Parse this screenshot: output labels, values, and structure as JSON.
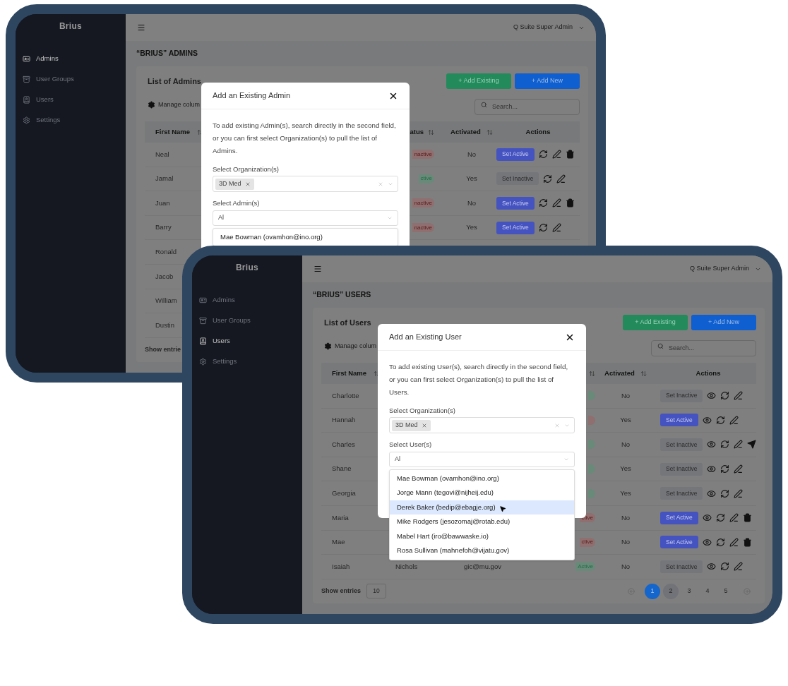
{
  "frames": [
    {
      "sidebar": {
        "brand": "Brius",
        "items": [
          {
            "label": "Admins",
            "selected": true
          },
          {
            "label": "User Groups",
            "selected": false
          },
          {
            "label": "Users",
            "selected": false
          },
          {
            "label": "Settings",
            "selected": false
          }
        ]
      },
      "header": {
        "user": "Q Suite Super Admin"
      },
      "page_title": "“BRIUS” ADMINS",
      "card": {
        "title": "List of Admins",
        "buttons": [
          {
            "label": "+ Add Existing",
            "kind": "secondary"
          },
          {
            "label": "+ Add New",
            "kind": "primary"
          }
        ],
        "manage_columns": "Manage colum",
        "search": {
          "placeholder": "Search..."
        },
        "headers": [
          {
            "kind": "first_name",
            "label": "First Name",
            "sortable": true
          },
          {
            "kind": "status",
            "label": "atus",
            "sortable": true
          },
          {
            "kind": "activated",
            "label": "Activated",
            "sortable": true
          },
          {
            "kind": "actions",
            "label": "Actions",
            "sortable": false
          }
        ],
        "rows": [
          {
            "first_name": "Neal",
            "status": {
              "text": "nactive",
              "active": false
            },
            "activated": "No",
            "action": {
              "label": "Set Active",
              "kind": "primary"
            },
            "icons": [
              {
                "kind": "sync"
              },
              {
                "kind": "edit"
              },
              {
                "kind": "delete"
              }
            ]
          },
          {
            "first_name": "Jamal",
            "status": {
              "text": "ctive",
              "active": true
            },
            "activated": "Yes",
            "action": {
              "label": "Set Inactive",
              "kind": "secondary"
            },
            "icons": [
              {
                "kind": "sync"
              },
              {
                "kind": "edit"
              }
            ]
          },
          {
            "first_name": "Juan",
            "status": {
              "text": "nactive",
              "active": false
            },
            "activated": "No",
            "action": {
              "label": "Set Active",
              "kind": "primary"
            },
            "icons": [
              {
                "kind": "sync"
              },
              {
                "kind": "edit"
              },
              {
                "kind": "delete"
              }
            ]
          },
          {
            "first_name": "Barry",
            "status": {
              "text": "nactive",
              "active": false
            },
            "activated": "Yes",
            "action": {
              "label": "Set Active",
              "kind": "primary"
            },
            "icons": [
              {
                "kind": "sync"
              },
              {
                "kind": "edit"
              }
            ]
          },
          {
            "first_name": "Ronald"
          },
          {
            "first_name": "Jacob"
          },
          {
            "first_name": "William"
          },
          {
            "first_name": "Dustin"
          }
        ],
        "footer": {
          "show_entries": "Show entrie"
        }
      },
      "modal": {
        "title": "Add an Existing Admin",
        "description": "To add existing Admin(s), search directly in the second field, or you can first select Organization(s) to pull the list of Admins.",
        "org_label": "Select Organization(s)",
        "org_chips": [
          {
            "label": "3D Med"
          }
        ],
        "user_label": "Select Admin(s)",
        "user_value": "Al",
        "options": [
          {
            "label": "Mae Bowman (ovamhon@ino.org)",
            "selected": false
          }
        ]
      }
    },
    {
      "sidebar": {
        "brand": "Brius",
        "items": [
          {
            "label": "Admins",
            "selected": false
          },
          {
            "label": "User Groups",
            "selected": false
          },
          {
            "label": "Users",
            "selected": true
          },
          {
            "label": "Settings",
            "selected": false
          }
        ]
      },
      "header": {
        "user": "Q Suite Super Admin"
      },
      "page_title": "“BRIUS” USERS",
      "card": {
        "title": "List of Users",
        "buttons": [
          {
            "label": "+ Add Existing",
            "kind": "secondary"
          },
          {
            "label": "+ Add New",
            "kind": "primary"
          }
        ],
        "manage_columns": "Manage colum",
        "search": {
          "placeholder": "Search..."
        },
        "headers": [
          {
            "kind": "first_name",
            "label": "First Name",
            "sortable": true
          },
          {
            "kind": "status",
            "sortable": true
          },
          {
            "kind": "activated",
            "label": "Activated",
            "sortable": true
          },
          {
            "kind": "actions",
            "label": "Actions",
            "sortable": false
          }
        ],
        "rows": [
          {
            "first_name": "Charlotte",
            "status": {
              "active": true
            },
            "activated": "No",
            "action": {
              "label": "Set Inactive",
              "kind": "secondary"
            },
            "icons": [
              {
                "kind": "view"
              },
              {
                "kind": "sync"
              },
              {
                "kind": "edit"
              }
            ]
          },
          {
            "first_name": "Hannah",
            "status": {
              "active": false
            },
            "activated": "Yes",
            "action": {
              "label": "Set Active",
              "kind": "primary"
            },
            "icons": [
              {
                "kind": "view"
              },
              {
                "kind": "sync"
              },
              {
                "kind": "edit"
              }
            ]
          },
          {
            "first_name": "Charles",
            "status": {
              "active": true
            },
            "activated": "No",
            "action": {
              "label": "Set Inactive",
              "kind": "secondary"
            },
            "icons": [
              {
                "kind": "view"
              },
              {
                "kind": "sync"
              },
              {
                "kind": "edit"
              },
              {
                "kind": "send"
              }
            ]
          },
          {
            "first_name": "Shane",
            "status": {
              "active": true
            },
            "activated": "Yes",
            "action": {
              "label": "Set Inactive",
              "kind": "secondary"
            },
            "icons": [
              {
                "kind": "view"
              },
              {
                "kind": "sync"
              },
              {
                "kind": "edit"
              }
            ]
          },
          {
            "first_name": "Georgia",
            "status": {
              "active": true
            },
            "activated": "Yes",
            "action": {
              "label": "Set Inactive",
              "kind": "secondary"
            },
            "icons": [
              {
                "kind": "view"
              },
              {
                "kind": "sync"
              },
              {
                "kind": "edit"
              }
            ]
          },
          {
            "first_name": "Maria",
            "status": {
              "text": "ctive",
              "active": false
            },
            "activated": "No",
            "action": {
              "label": "Set Active",
              "kind": "primary"
            },
            "icons": [
              {
                "kind": "view"
              },
              {
                "kind": "sync"
              },
              {
                "kind": "edit"
              },
              {
                "kind": "delete"
              }
            ]
          },
          {
            "first_name": "Mae",
            "status": {
              "text": "ctive",
              "active": false
            },
            "activated": "No",
            "action": {
              "label": "Set Active",
              "kind": "primary"
            },
            "icons": [
              {
                "kind": "view"
              },
              {
                "kind": "sync"
              },
              {
                "kind": "edit"
              },
              {
                "kind": "delete"
              }
            ]
          },
          {
            "first_name": "Isaiah",
            "last_name": "Nichols",
            "email": "gic@mu.gov",
            "status": {
              "text": "Active",
              "active": true
            },
            "activated": "No",
            "action": {
              "label": "Set Inactive",
              "kind": "secondary"
            },
            "icons": [
              {
                "kind": "view"
              },
              {
                "kind": "sync"
              },
              {
                "kind": "edit"
              }
            ]
          }
        ],
        "footer": {
          "show_entries": "Show entries",
          "page_size": "10",
          "pages": [
            {
              "label": "1",
              "selected": true,
              "hovered": false
            },
            {
              "label": "2",
              "selected": false,
              "hovered": true
            },
            {
              "label": "3",
              "selected": false,
              "hovered": false
            },
            {
              "label": "4",
              "selected": false,
              "hovered": false
            },
            {
              "label": "5",
              "selected": false,
              "hovered": false
            }
          ]
        }
      },
      "modal": {
        "title": "Add an Existing User",
        "description": "To add existing User(s), search directly in the second field, or you can first select Organization(s) to pull the list of Users.",
        "org_label": "Select Organization(s)",
        "org_chips": [
          {
            "label": "3D Med"
          }
        ],
        "user_label": "Select User(s)",
        "user_value": "Al",
        "options": [
          {
            "label": "Mae Bowman (ovamhon@ino.org)",
            "selected": false
          },
          {
            "label": "Jorge Mann (tegovi@nijheij.edu)",
            "selected": false
          },
          {
            "label": "Derek Baker (bedip@ebagje.org)",
            "selected": true
          },
          {
            "label": "Mike Rodgers (jesozomaj@rotab.edu)",
            "selected": false
          },
          {
            "label": "Mabel Hart (iro@bawwaske.io)",
            "selected": false
          },
          {
            "label": "Rosa Sullivan (mahnefoh@vijatu.gov)",
            "selected": false
          }
        ]
      }
    }
  ]
}
